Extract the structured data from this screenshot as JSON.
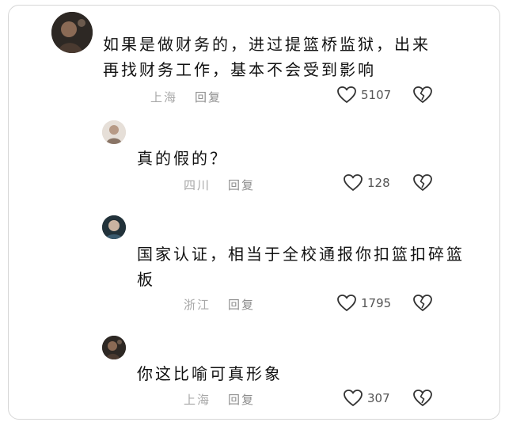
{
  "comments": [
    {
      "text": "如果是做财务的，进过提篮桥监狱，出来再找财务工作，基本不会受到影响",
      "location": "上海",
      "reply_label": "回复",
      "likes": "5107"
    },
    {
      "text": "真的假的？",
      "location": "四川",
      "reply_label": "回复",
      "likes": "128"
    },
    {
      "text": "国家认证，相当于全校通报你扣篮扣碎篮板",
      "location": "浙江",
      "reply_label": "回复",
      "likes": "1795"
    },
    {
      "text": "你这比喻可真形象",
      "location": "上海",
      "reply_label": "回复",
      "likes": "307"
    }
  ],
  "icons": {
    "like": "heart-outline-icon",
    "dislike": "broken-heart-icon"
  },
  "colors": {
    "text": "#111111",
    "meta": "#a8a8a8",
    "icon": "#333333"
  }
}
